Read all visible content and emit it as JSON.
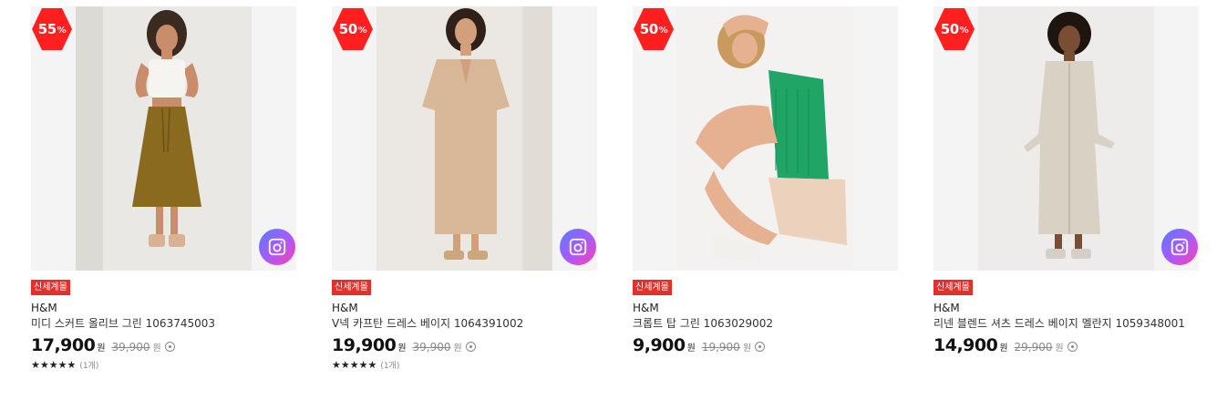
{
  "products": [
    {
      "discount": "55",
      "discount_unit": "%",
      "store_tag": "신세계몰",
      "brand": "H&M",
      "name": "미디 스커트 올리브 그린 1063745003",
      "price": "17,900",
      "price_unit": "원",
      "original_price": "39,900",
      "original_unit": "원",
      "stars": "★★★★★",
      "review_count": "(1개)",
      "has_camera": true,
      "colors": {
        "bg": "#e9e8e4",
        "skin": "#c98d6c",
        "top": "#f6f4f0",
        "bottom": "#8a6a1f",
        "shoe": "#d8b292"
      }
    },
    {
      "discount": "50",
      "discount_unit": "%",
      "store_tag": "신세계몰",
      "brand": "H&M",
      "name": "V넥 카프탄 드레스 베이지 1064391002",
      "price": "19,900",
      "price_unit": "원",
      "original_price": "39,900",
      "original_unit": "원",
      "stars": "★★★★★",
      "review_count": "(1개)",
      "has_camera": true,
      "colors": {
        "bg": "#ebe8e3",
        "skin": "#d3a07c",
        "top": "#d8b898",
        "bottom": "#d8b898",
        "shoe": "#caa77d"
      }
    },
    {
      "discount": "50",
      "discount_unit": "%",
      "store_tag": "신세계몰",
      "brand": "H&M",
      "name": "크롭트 탑 그린 1063029002",
      "price": "9,900",
      "price_unit": "원",
      "original_price": "19,900",
      "original_unit": "원",
      "stars": "",
      "review_count": "",
      "has_camera": false,
      "colors": {
        "bg": "#f3f2f0",
        "skin": "#e6b190",
        "top": "#21a566",
        "bottom": "#ecd2bd",
        "shoe": "#f2f0ec"
      }
    },
    {
      "discount": "50",
      "discount_unit": "%",
      "store_tag": "신세계몰",
      "brand": "H&M",
      "name": "리넨 블렌드 셔츠 드레스 베이지 멜란지 1059348001",
      "price": "14,900",
      "price_unit": "원",
      "original_price": "29,900",
      "original_unit": "원",
      "stars": "",
      "review_count": "",
      "has_camera": true,
      "colors": {
        "bg": "#eeecea",
        "skin": "#7a4e34",
        "top": "#d9d1c4",
        "bottom": "#d9d1c4",
        "shoe": "#d4cfc8"
      }
    }
  ]
}
